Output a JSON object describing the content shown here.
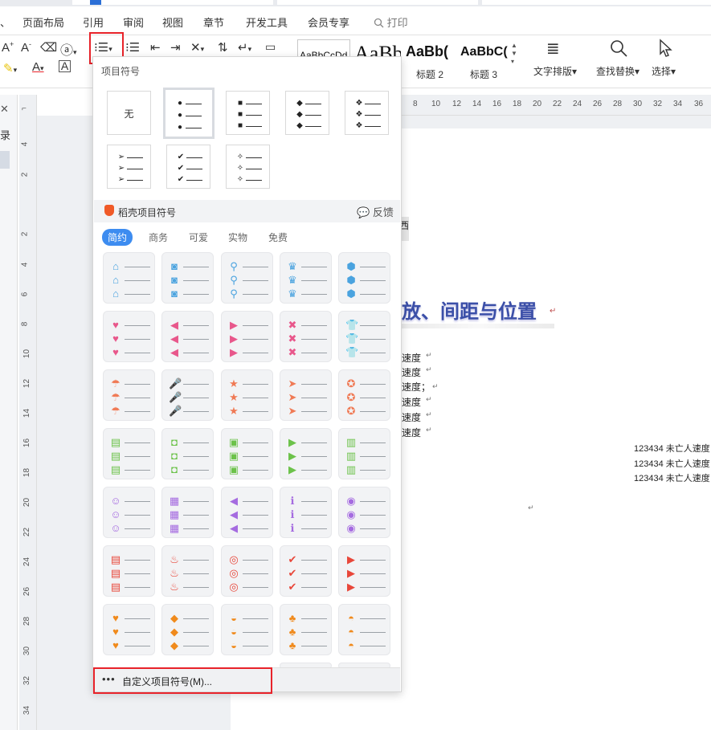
{
  "menubar": {
    "items": [
      "页面布局",
      "引用",
      "审阅",
      "视图",
      "章节",
      "开发工具",
      "会员专享"
    ],
    "search_label": "打印"
  },
  "ribbon": {
    "styles": [
      {
        "sample": "AaBbCcDd",
        "caption": ""
      },
      {
        "sample": "AaBb",
        "caption": ""
      },
      {
        "sample": "AaBb(",
        "caption": "标题 2"
      },
      {
        "sample": "AaBbC(",
        "caption": "标题 3"
      }
    ],
    "text_layout": "文字排版",
    "find_replace": "查找替换",
    "select": "选择"
  },
  "ruler": {
    "top": [
      "8",
      "10",
      "12",
      "14",
      "16",
      "18",
      "20",
      "22",
      "24",
      "26",
      "28",
      "30",
      "32",
      "34",
      "36"
    ],
    "left": [
      "4",
      "2",
      "2",
      "4",
      "6",
      "8",
      "10",
      "12",
      "14",
      "16",
      "18",
      "20",
      "22",
      "24",
      "26",
      "28",
      "30",
      "32",
      "34"
    ]
  },
  "leftpanel": {
    "label": "录"
  },
  "dropdown": {
    "section_title": "项目符号",
    "none_label": "无",
    "docer_title": "稻壳项目符号",
    "feedback": "反馈",
    "tabs": [
      "简约",
      "商务",
      "可爱",
      "实物",
      "免费"
    ],
    "custom_label": "自定义项目符号(M)...",
    "basic_bullets": [
      "●",
      "■",
      "◆",
      "❖",
      "➢",
      "✔",
      "✧"
    ],
    "icon_rows": [
      {
        "color": "#4aa3df",
        "icons": [
          "⌂",
          "◙",
          "⚲",
          "♛",
          "⬢"
        ]
      },
      {
        "color": "#e8578b",
        "icons": [
          "♥",
          "◀",
          "▶",
          "✖",
          "👕"
        ]
      },
      {
        "color": "#f07a55",
        "icons": [
          "☂",
          "🎤",
          "★",
          "➤",
          "✪"
        ]
      },
      {
        "color": "#6cc24a",
        "icons": [
          "▤",
          "◘",
          "▣",
          "▶",
          "▥"
        ]
      },
      {
        "color": "#a56be0",
        "icons": [
          "☺",
          "▦",
          "◀",
          "ℹ",
          "◉"
        ]
      },
      {
        "color": "#e8473a",
        "icons": [
          "▤",
          "♨",
          "◎",
          "✔",
          "▶"
        ]
      },
      {
        "color": "#f08a1c",
        "icons": [
          "♥",
          "◆",
          "◒",
          "♣",
          "◓"
        ]
      }
    ]
  },
  "document": {
    "heading": "放、间距与位置",
    "small_cell": "西",
    "speed_lines": [
      "速度",
      "速度",
      "速度；",
      "速度",
      "速度",
      "速度"
    ],
    "table_lines": [
      "123434 未亡人速度",
      "123434 未亡人速度",
      "123434 未亡人速度"
    ],
    "para_mark": "↵"
  },
  "colors": {
    "accent": "#3d8cf0",
    "highlight": "#e8232a",
    "docer_logo": "#f05a28"
  }
}
